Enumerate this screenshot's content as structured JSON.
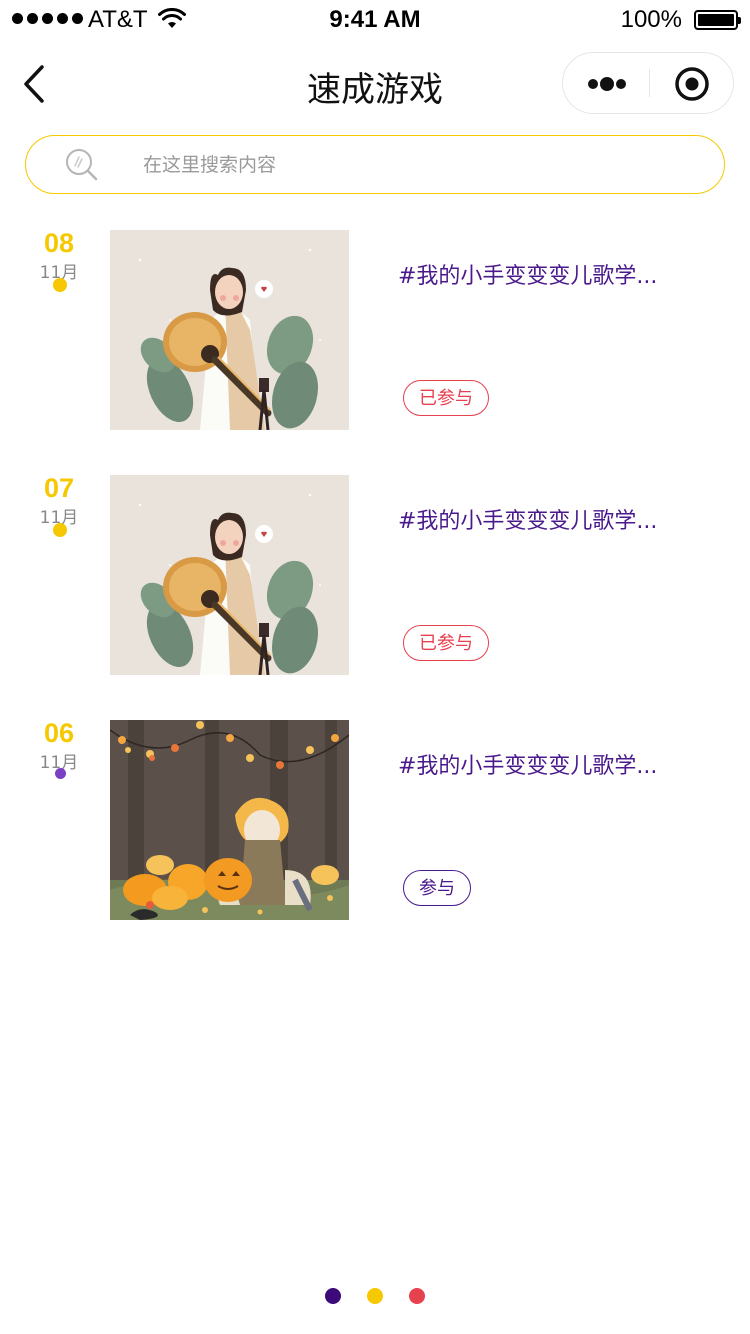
{
  "status_bar": {
    "carrier": "AT&T",
    "time": "9:41 AM",
    "battery": "100%",
    "battery_level": 1.0
  },
  "nav": {
    "title": "速成游戏",
    "back_icon": "chevron-left-icon",
    "more_icon": "more-dots-icon",
    "close_icon": "target-icon"
  },
  "search": {
    "placeholder": "在这里搜索内容",
    "icon": "search-icon"
  },
  "items": [
    {
      "day": "08",
      "month": "11月",
      "dot_color": "#f5c800",
      "image": "girl-with-guitar-illustration",
      "title": "#我的小手变变变儿歌学...",
      "button": "已参与",
      "status": "joined"
    },
    {
      "day": "07",
      "month": "11月",
      "dot_color": "#f5c800",
      "image": "girl-with-guitar-illustration",
      "title": "#我的小手变变变儿歌学...",
      "button": "已参与",
      "status": "joined"
    },
    {
      "day": "06",
      "month": "11月",
      "dot_color": "#7b3fc4",
      "image": "pumpkin-forest-illustration",
      "title": "#我的小手变变变儿歌学...",
      "button": "参与",
      "status": "open"
    }
  ],
  "pager": {
    "dots": [
      "#3d0a7a",
      "#f5c800",
      "#e8414e"
    ]
  },
  "colors": {
    "accent_yellow": "#f5c800",
    "accent_purple": "#4a1a8c",
    "accent_red": "#e8414e"
  }
}
